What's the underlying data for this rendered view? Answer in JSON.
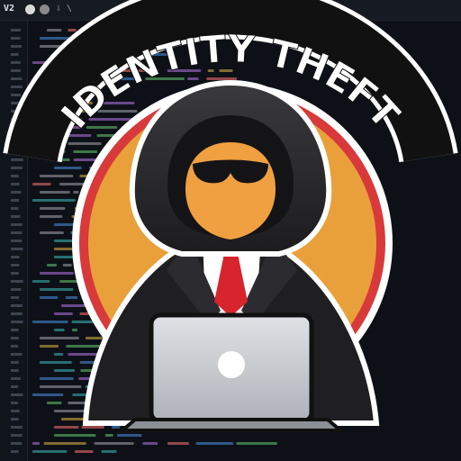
{
  "editor": {
    "title": "V2",
    "window_buttons": [
      "close",
      "minimize"
    ],
    "status_glyph": "⇩ \\"
  },
  "logo": {
    "title": "IDENTITY THEFT",
    "colors": {
      "sun": "#e9a03b",
      "ring_outer": "#d8393a",
      "band": "#111111",
      "band_stroke": "#ffffff",
      "hood": "#2b2b2d",
      "hood_shadow": "#1a1a1c",
      "face": "#f0a040",
      "suit": "#1f1f22",
      "shirt": "#ffffff",
      "tie": "#d8242d",
      "laptop": "#c9ccd1",
      "laptop_dark": "#8c9096"
    },
    "icons": [
      "hooded-hacker-figure",
      "laptop-icon"
    ]
  }
}
